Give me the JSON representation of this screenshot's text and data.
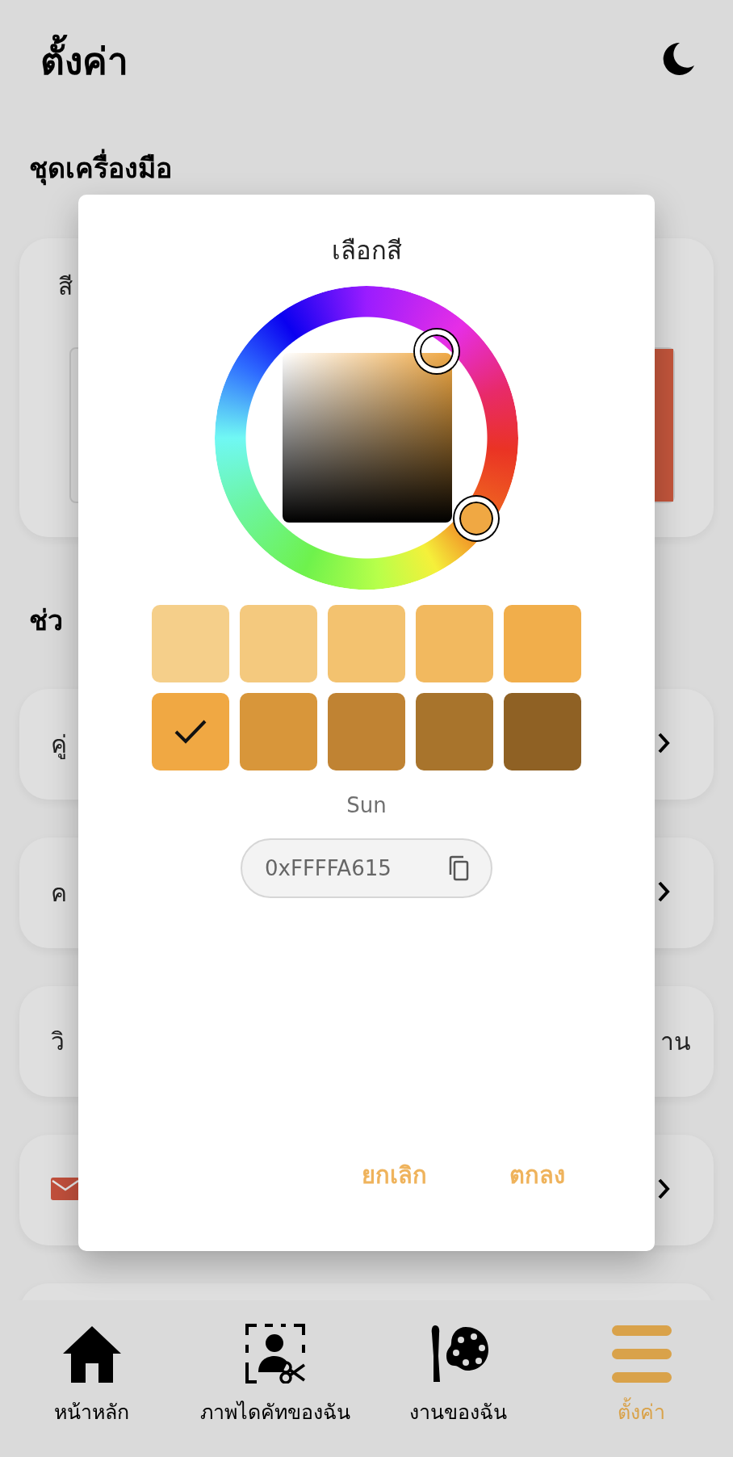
{
  "header": {
    "title": "ตั้งค่า"
  },
  "toolkit": {
    "heading": "ชุดเครื่องมือ",
    "label": "สี",
    "color": "#c4563c"
  },
  "help": {
    "heading": "ช่ว",
    "rows": [
      {
        "kind": "link",
        "label": "คู่"
      },
      {
        "kind": "link",
        "label": "ค"
      },
      {
        "kind": "value",
        "label": "วิ",
        "value": "าน"
      },
      {
        "kind": "mail"
      },
      {
        "kind": "blank"
      }
    ]
  },
  "dialog": {
    "title": "เลือกสี",
    "swatches": [
      {
        "color": "#f5cf8a",
        "selected": false
      },
      {
        "color": "#f4c97e",
        "selected": false
      },
      {
        "color": "#f3c26f",
        "selected": false
      },
      {
        "color": "#f2b95f",
        "selected": false
      },
      {
        "color": "#f1ae4b",
        "selected": false
      },
      {
        "color": "#f0a843",
        "selected": true
      },
      {
        "color": "#d8963a",
        "selected": false
      },
      {
        "color": "#c08333",
        "selected": false
      },
      {
        "color": "#a8742c",
        "selected": false
      },
      {
        "color": "#8f6124",
        "selected": false
      }
    ],
    "color_name": "Sun",
    "hex": "0xFFFFA615",
    "buttons": [
      "ยกเลิก",
      "ตกลง"
    ]
  },
  "nav": [
    {
      "kind": "home",
      "label": "หน้าหลัก",
      "selected": false
    },
    {
      "kind": "cutout",
      "label": "ภาพไดคัทของฉัน",
      "selected": false
    },
    {
      "kind": "palette",
      "label": "งานของฉัน",
      "selected": false
    },
    {
      "kind": "menu",
      "label": "ตั้งค่า",
      "selected": true
    }
  ]
}
